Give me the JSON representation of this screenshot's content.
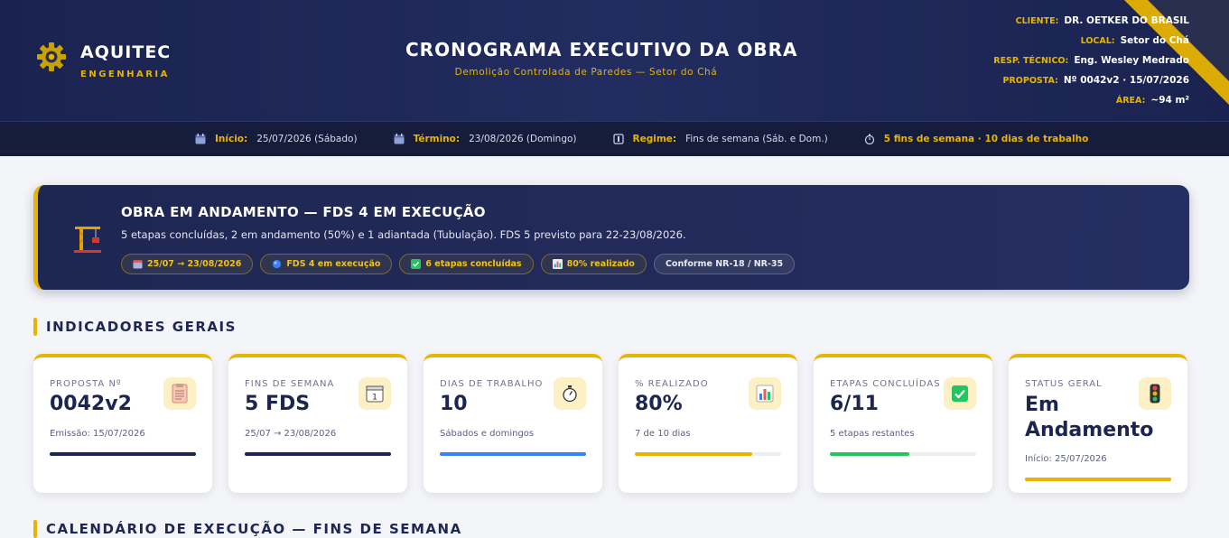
{
  "brand": {
    "name": "AQUITEC",
    "tagline": "ENGENHARIA"
  },
  "header": {
    "title": "CRONOGRAMA EXECUTIVO DA OBRA",
    "subtitle": "Demolição Controlada de Paredes — Setor do Chá",
    "info": [
      {
        "key": "CLIENTE:",
        "value": "DR. OETKER DO BRASIL"
      },
      {
        "key": "LOCAL:",
        "value": "Setor do Chá"
      },
      {
        "key": "RESP. TÉCNICO:",
        "value": "Eng. Wesley Medrado"
      },
      {
        "key": "PROPOSTA:",
        "value": "Nº 0042v2 · 15/07/2026"
      },
      {
        "key": "ÁREA:",
        "value": "~94 m²"
      }
    ]
  },
  "schedule_bar": {
    "start_label": "Início:",
    "start_value": "25/07/2026 (Sábado)",
    "end_label": "Término:",
    "end_value": "23/08/2026 (Domingo)",
    "regime_label": "Regime:",
    "regime_value": "Fins de semana (Sáb. e Dom.)",
    "summary": "5 fins de semana · 10 dias de trabalho",
    "icons": [
      "calendar-icon",
      "calendar-icon",
      "regime-icon",
      "stopwatch-icon"
    ]
  },
  "banner": {
    "icon": "crane-icon",
    "title": "OBRA EM ANDAMENTO — FDS 4 EM EXECUÇÃO",
    "description": "5 etapas concluídas, 2 em andamento (50%) e 1 adiantada (Tubulação). FDS 5 previsto para 22-23/08/2026.",
    "chips": [
      {
        "label": "25/07 → 23/08/2026",
        "icon": "calendar-icon"
      },
      {
        "label": "FDS 4 em execução",
        "icon": "blue-dot-icon"
      },
      {
        "label": "6 etapas concluídas",
        "icon": "check-icon"
      },
      {
        "label": "80% realizado",
        "icon": "chart-icon"
      },
      {
        "label": "Conforme NR-18 / NR-35",
        "icon": ""
      }
    ]
  },
  "sections": {
    "indicators": "INDICADORES GERAIS",
    "calendar": "CALENDÁRIO DE EXECUÇÃO — FINS DE SEMANA"
  },
  "cards": [
    {
      "label": "PROPOSTA Nº",
      "value": "0042v2",
      "sub": "Emissão: 15/07/2026",
      "icon": "document-icon",
      "progress": 1.0,
      "color": "#1c2450"
    },
    {
      "label": "FINS DE SEMANA",
      "value": "5 FDS",
      "sub": "25/07 → 23/08/2026",
      "icon": "calendar-icon",
      "progress": 1.0,
      "color": "#1c2450"
    },
    {
      "label": "DIAS DE TRABALHO",
      "value": "10",
      "sub": "Sábados e domingos",
      "icon": "stopwatch-icon",
      "progress": 1.0,
      "color": "#3b82f6"
    },
    {
      "label": "% REALIZADO",
      "value": "80%",
      "sub": "7 de 10 dias",
      "icon": "bar-chart-icon",
      "progress": 0.8,
      "color": "#e8b400"
    },
    {
      "label": "ETAPAS CONCLUÍDAS",
      "value": "6/11",
      "sub": "5 etapas restantes",
      "icon": "check-icon",
      "progress": 0.545,
      "color": "#22c55e"
    },
    {
      "label": "STATUS GERAL",
      "value": "Em Andamento",
      "sub": "Início: 25/07/2026",
      "icon": "traffic-light-icon",
      "progress": 1.0,
      "color": "#e8b400"
    }
  ]
}
